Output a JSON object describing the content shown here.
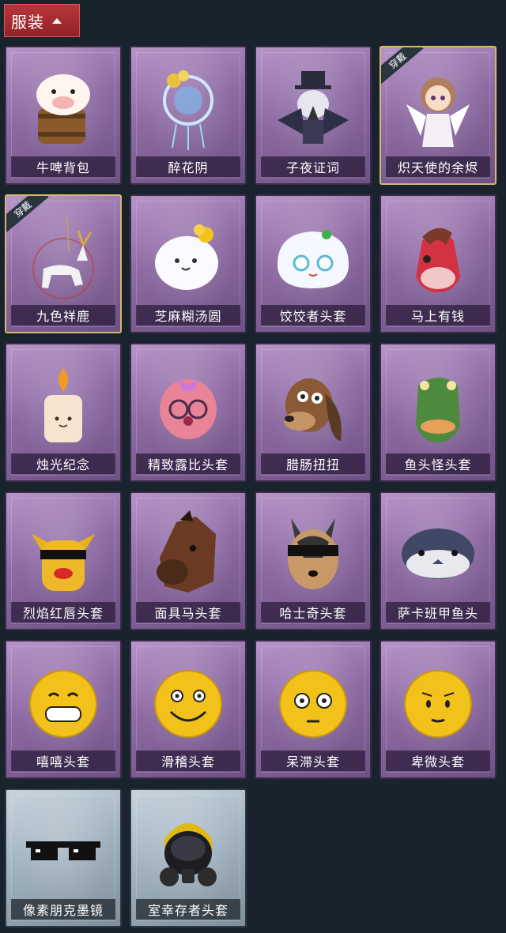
{
  "header": {
    "title": "服装",
    "icon": "chevron-up-icon"
  },
  "worn_tag": "穿戴",
  "items": [
    {
      "name": "牛啤背包",
      "worn": false,
      "frame": "purple",
      "icon": "cow-beer-backpack-icon"
    },
    {
      "name": "醉花阴",
      "worn": false,
      "frame": "purple",
      "icon": "flower-dreamcatcher-icon"
    },
    {
      "name": "子夜证词",
      "worn": false,
      "frame": "purple",
      "icon": "crow-gentleman-icon"
    },
    {
      "name": "炽天使的余烬",
      "worn": true,
      "frame": "purple",
      "icon": "angel-doll-icon"
    },
    {
      "name": "九色祥鹿",
      "worn": true,
      "frame": "purple",
      "icon": "deer-charm-icon"
    },
    {
      "name": "芝麻糊汤圆",
      "worn": false,
      "frame": "purple",
      "icon": "tangyuan-icon"
    },
    {
      "name": "饺饺者头套",
      "worn": false,
      "frame": "purple",
      "icon": "dumpling-head-icon"
    },
    {
      "name": "马上有钱",
      "worn": false,
      "frame": "purple",
      "icon": "red-horse-icon"
    },
    {
      "name": "烛光纪念",
      "worn": false,
      "frame": "purple",
      "icon": "candle-icon"
    },
    {
      "name": "精致露比头套",
      "worn": false,
      "frame": "purple",
      "icon": "pink-beaver-icon"
    },
    {
      "name": "腊肠扭扭",
      "worn": false,
      "frame": "purple",
      "icon": "dachshund-icon"
    },
    {
      "name": "鱼头怪头套",
      "worn": false,
      "frame": "purple",
      "icon": "fish-head-icon"
    },
    {
      "name": "烈焰红唇头套",
      "worn": false,
      "frame": "purple",
      "icon": "yellow-mouse-icon"
    },
    {
      "name": "面具马头套",
      "worn": false,
      "frame": "purple",
      "icon": "horse-mask-icon"
    },
    {
      "name": "哈士奇头套",
      "worn": false,
      "frame": "purple",
      "icon": "husky-icon"
    },
    {
      "name": "萨卡班甲鱼头",
      "worn": false,
      "frame": "purple",
      "icon": "sacabambaspis-icon"
    },
    {
      "name": "嘻嘻头套",
      "worn": false,
      "frame": "purple",
      "icon": "grin-emoji-icon"
    },
    {
      "name": "滑稽头套",
      "worn": false,
      "frame": "purple",
      "icon": "silly-emoji-icon"
    },
    {
      "name": "呆滞头套",
      "worn": false,
      "frame": "purple",
      "icon": "stare-emoji-icon"
    },
    {
      "name": "卑微头套",
      "worn": false,
      "frame": "purple",
      "icon": "humble-emoji-icon"
    },
    {
      "name": "像素朋克墨镜",
      "worn": false,
      "frame": "gray",
      "icon": "pixel-sunglasses-icon"
    },
    {
      "name": "室幸存者头套",
      "worn": false,
      "frame": "gray",
      "icon": "gas-mask-icon"
    }
  ]
}
